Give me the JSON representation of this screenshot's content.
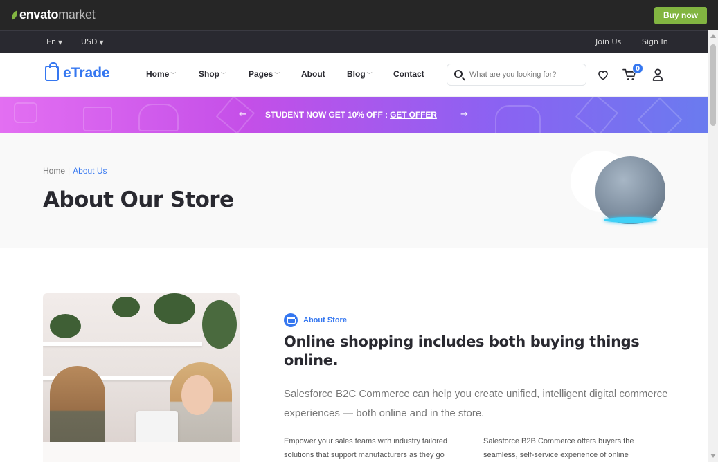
{
  "envato": {
    "logo_word1": "envato",
    "logo_word2": "market",
    "buy_now": "Buy now"
  },
  "top_header": {
    "language": "En",
    "currency": "USD",
    "join_us": "Join Us",
    "sign_in": "Sign In"
  },
  "nav": {
    "logo": "eTrade",
    "items": [
      {
        "label": "Home",
        "has_dropdown": true
      },
      {
        "label": "Shop",
        "has_dropdown": true
      },
      {
        "label": "Pages",
        "has_dropdown": true
      },
      {
        "label": "About",
        "has_dropdown": false
      },
      {
        "label": "Blog",
        "has_dropdown": true
      },
      {
        "label": "Contact",
        "has_dropdown": false
      }
    ],
    "search_placeholder": "What are you looking for?",
    "cart_count": "0",
    "icons": [
      "search-icon",
      "heart-icon",
      "cart-icon",
      "user-icon"
    ]
  },
  "promo": {
    "text": "STUDENT NOW GET 10% OFF :",
    "link": "GET OFFER"
  },
  "breadcrumb": {
    "home": "Home",
    "current": "About Us"
  },
  "page_title": "About Our Store",
  "about": {
    "badge": "About Store",
    "heading": "Online shopping includes both buying things online.",
    "lead": "Salesforce B2C Commerce can help you create unified, intelligent digital commerce experiences — both online and in the store.",
    "col1": "Empower your sales teams with industry tailored solutions that support manufacturers as they go",
    "col2": "Salesforce B2B Commerce offers buyers the seamless, self-service experience of online"
  },
  "colors": {
    "accent": "#3577f0",
    "envato_green": "#82b541",
    "dark": "#292930"
  }
}
